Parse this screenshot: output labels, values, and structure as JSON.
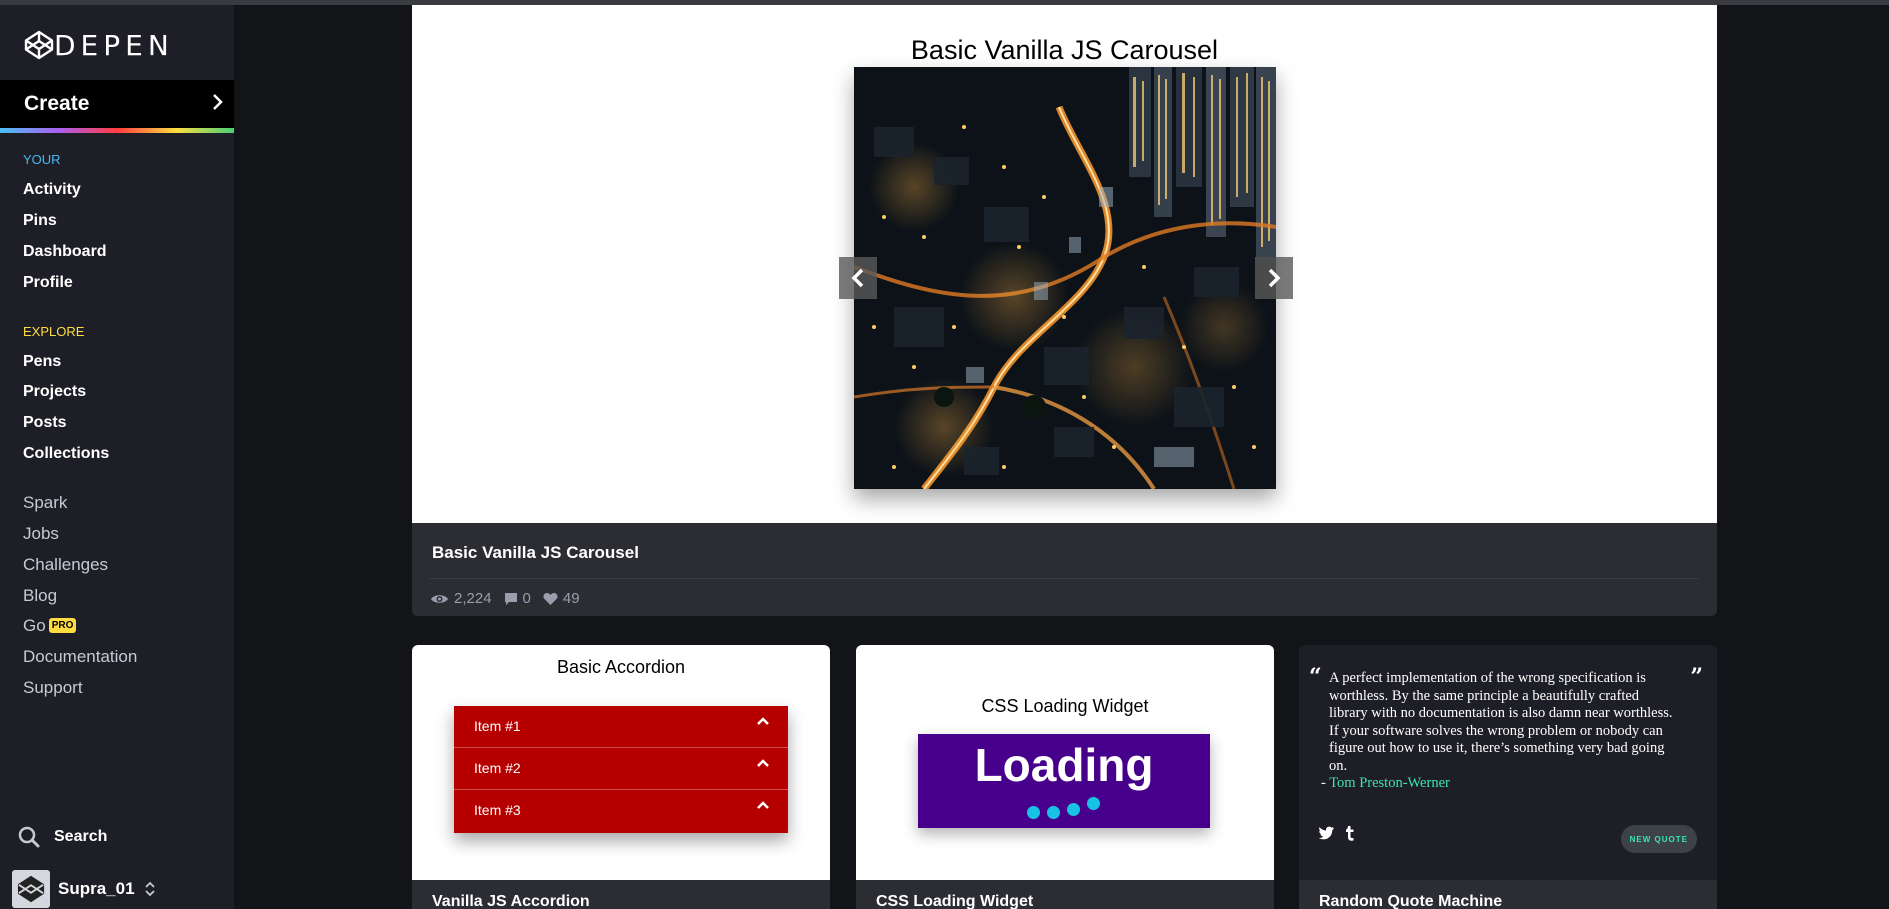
{
  "brand": {
    "logo_text": "DEPEN",
    "logo_icon": "codepen-cube-icon"
  },
  "sidebar": {
    "create_label": "Create",
    "your_label": "YOUR",
    "your_items": [
      "Activity",
      "Pins",
      "Dashboard",
      "Profile"
    ],
    "explore_label": "EXPLORE",
    "explore_items": [
      "Pens",
      "Projects",
      "Posts",
      "Collections"
    ],
    "extra_items": [
      "Spark",
      "Jobs",
      "Challenges",
      "Blog",
      "Go",
      "Documentation",
      "Support"
    ],
    "pro_badge": "PRO",
    "search_label": "Search",
    "username": "Supra_01",
    "colors": {
      "your": "#47b8f0",
      "explore": "#ffdd40"
    }
  },
  "featured": {
    "preview_title": "Basic Vanilla JS Carousel",
    "card_title": "Basic Vanilla JS Carousel",
    "views": "2,224",
    "comments": "0",
    "likes": "49",
    "prev_arrow": "‹",
    "next_arrow": "›"
  },
  "cards": {
    "accordion": {
      "preview_title": "Basic Accordion",
      "items": [
        "Item #1",
        "Item #2",
        "Item #3"
      ],
      "card_title": "Vanilla JS Accordion"
    },
    "loading": {
      "preview_title": "CSS Loading Widget",
      "loading_text": "Loading",
      "card_title": "CSS Loading Widget"
    },
    "quote": {
      "text": "A perfect implementation of the wrong specification is worthless. By the same principle a beautifully crafted library with no documentation is also damn near worthless. If your software solves the wrong problem or nobody can figure out how to use it, there’s something very bad going on.",
      "author_prefix": "- ",
      "author": "Tom Preston-Werner",
      "twitter": "t",
      "tumblr": "t",
      "new_quote_label": "NEW QUOTE",
      "card_title": "Random Quote Machine"
    }
  }
}
